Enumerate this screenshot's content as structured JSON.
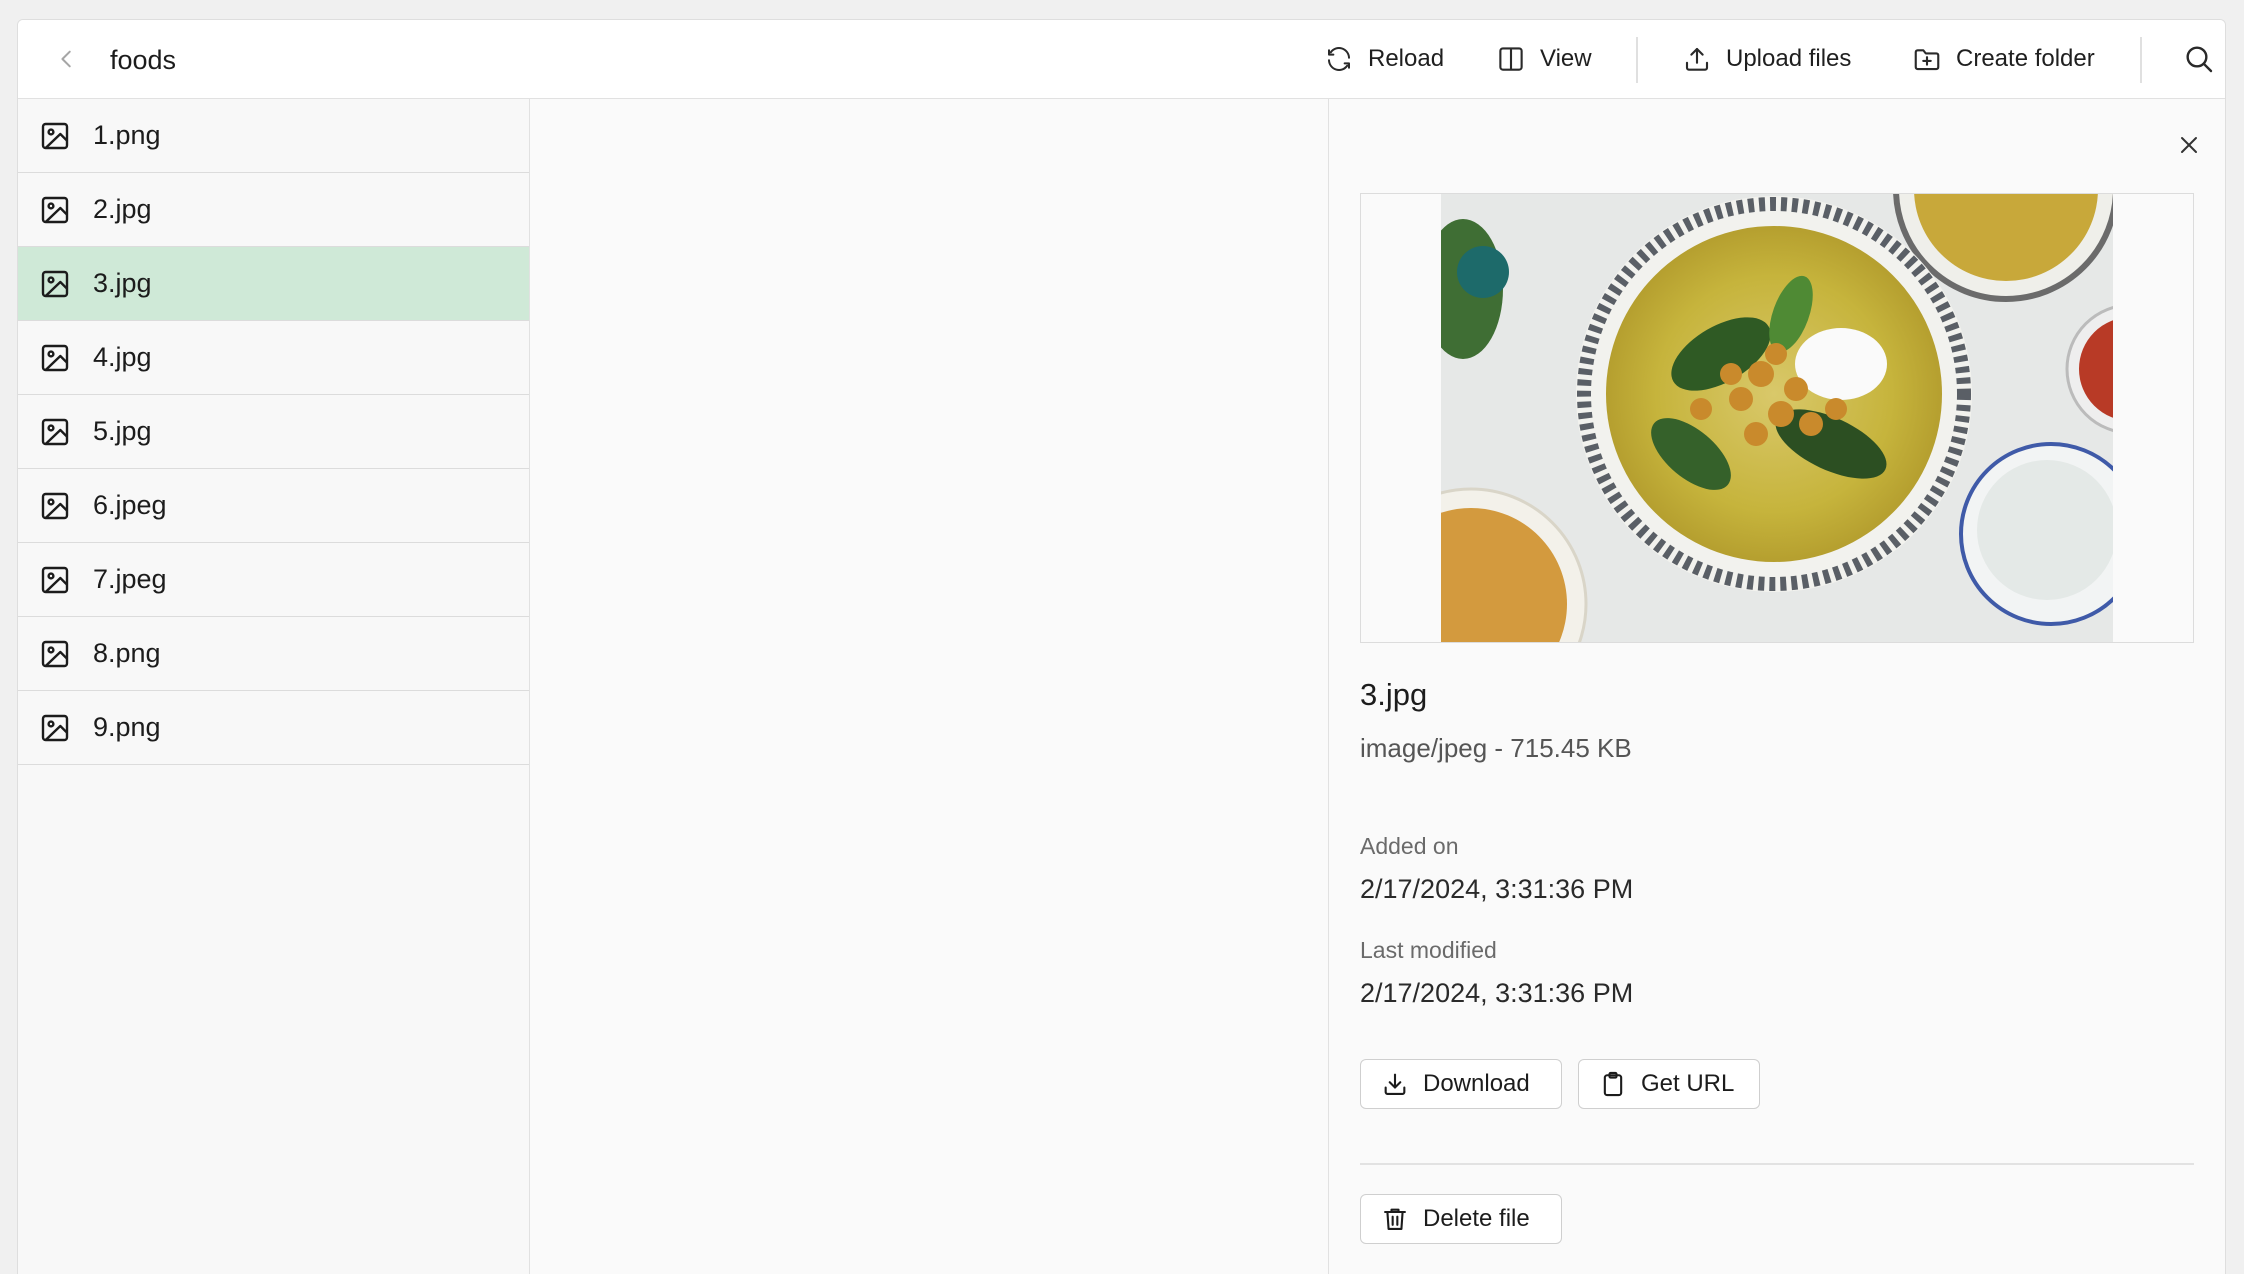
{
  "header": {
    "folder_name": "foods",
    "reload_label": "Reload",
    "view_label": "View",
    "upload_label": "Upload files",
    "create_folder_label": "Create folder"
  },
  "files": [
    {
      "name": "1.png"
    },
    {
      "name": "2.jpg"
    },
    {
      "name": "3.jpg"
    },
    {
      "name": "4.jpg"
    },
    {
      "name": "5.jpg"
    },
    {
      "name": "6.jpeg"
    },
    {
      "name": "7.jpeg"
    },
    {
      "name": "8.png"
    },
    {
      "name": "9.png"
    }
  ],
  "selected_index": 2,
  "details": {
    "name": "3.jpg",
    "meta": "image/jpeg - 715.45 KB",
    "added_label": "Added on",
    "added_value": "2/17/2024, 3:31:36 PM",
    "modified_label": "Last modified",
    "modified_value": "2/17/2024, 3:31:36 PM",
    "download_label": "Download",
    "get_url_label": "Get URL",
    "delete_label": "Delete file"
  },
  "colors": {
    "selected_row": "#cfe9d7"
  }
}
